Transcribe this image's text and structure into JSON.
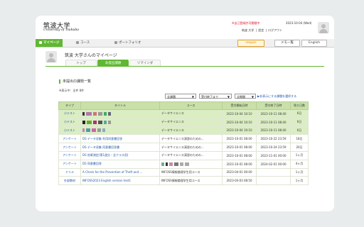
{
  "header": {
    "logo_ja": "筑波大学",
    "logo_en": "University of Tsukuba",
    "alert": "※自己登録許可期間中",
    "date": "2023-10-04 (Wed)",
    "links": [
      "筑波 大学",
      "|",
      "設定",
      "|",
      "ログアウト"
    ]
  },
  "nav": {
    "tabs": [
      {
        "label": "マイページ",
        "icon": "home-icon"
      },
      {
        "label": "コース",
        "icon": "course-icon"
      },
      {
        "label": "ポートフォリオ",
        "icon": "portfolio-icon"
      }
    ],
    "respon": "respon",
    "memo": "メモ一覧",
    "lang": "English"
  },
  "profile": {
    "title": "筑波 大学さんのマイページ",
    "subtabs": [
      "トップ",
      "未提出課題",
      "リマインダ"
    ]
  },
  "tasks": {
    "section_title": "未提出の課題一覧",
    "count": "※表示中：全件 8件",
    "filter_all": "全課題",
    "filter_deadline": "受付終了まで",
    "filter_period": "全期間",
    "show_link": "非表示にする課題を選択する",
    "columns": [
      "タイプ",
      "タイトル",
      "コース",
      "受付開始日時",
      "受付終了日時",
      "残り日数"
    ],
    "rows": [
      {
        "type": "小テスト",
        "title": "",
        "blocks": [
          {
            "c": "#333",
            "w": 3
          },
          {
            "c": "#b07aa8",
            "w": 8
          },
          {
            "c": "#c77",
            "w": 5
          },
          {
            "c": "#999",
            "w": 6
          },
          {
            "c": "#4a6",
            "w": 4
          },
          {
            "c": "#667",
            "w": 4
          }
        ],
        "course": "データサイエンス",
        "start": "2023-10-04 10:10",
        "end": "2023-10-11 08:40",
        "remain": "6日",
        "hl": true
      },
      {
        "type": "小テスト",
        "title": "",
        "blocks": [
          {
            "c": "#222",
            "w": 4
          },
          {
            "c": "#6a3",
            "w": 7
          },
          {
            "c": "#a37",
            "w": 5
          },
          {
            "c": "#555",
            "w": 6
          },
          {
            "c": "#5a9",
            "w": 4
          },
          {
            "c": "#999",
            "w": 4
          }
        ],
        "course": "データサイエンス",
        "start": "2023-10-04 10:10",
        "end": "2023-10-11 08:40",
        "remain": "6日",
        "hl": true
      },
      {
        "type": "小テスト",
        "title": "",
        "blocks": [
          {
            "c": "#b8a",
            "w": 3
          },
          {
            "c": "#59a",
            "w": 6
          },
          {
            "c": "#c6a",
            "w": 6
          },
          {
            "c": "#999",
            "w": 5
          },
          {
            "c": "#8ac",
            "w": 4
          }
        ],
        "course": "データサイエンス",
        "start": "2023-10-04 10:10",
        "end": "2023-10-11 08:40",
        "remain": "6日",
        "hl": true
      },
      {
        "type": "アンケート",
        "title": "DS データ収集 利用同意書回答",
        "blocks": [],
        "course": "データサイエンス演習のための...",
        "start": "2023-10-01 08:00",
        "end": "2023-10-22 23:59",
        "remain": "18日",
        "hl": false
      },
      {
        "type": "アンケート",
        "title": "DS データ収集 同意書回答書",
        "blocks": [],
        "course": "データサイエンス演習のための...",
        "start": "2023-10-01 08:00",
        "end": "2023-10-24 23:59",
        "remain": "20日",
        "hl": false
      },
      {
        "type": "アンケート",
        "title": "DS 効果測定(第1週分・全クラス用)",
        "blocks": [],
        "course": "データサイエンス演習のための...",
        "start": "2023-10-01 08:00",
        "end": "2023-11-01 00:00",
        "remain": "1ヶ月",
        "hl": false
      },
      {
        "type": "アンケート",
        "title": "DS 同意書回答",
        "blocks": [],
        "course": "",
        "courseblocks": [
          {
            "c": "#7a9",
            "w": 4
          },
          {
            "c": "#333",
            "w": 3
          },
          {
            "c": "#c8a",
            "w": 5
          },
          {
            "c": "#777",
            "w": 6
          },
          {
            "c": "#aaa",
            "w": 5
          },
          {
            "c": "#aaa",
            "w": 6
          }
        ],
        "start": "2023-10-01 08:00",
        "end": "2024-02-01 00:00",
        "remain": "4ヶ月",
        "hl": false
      },
      {
        "type": "ドリル",
        "title": "A Check for the Prevention of Theft and ...",
        "blocks": [],
        "course": "INFOSS情報倫理学生用コース",
        "start": "2023-04-01 00:00",
        "end": "",
        "remain": "1ヶ月",
        "hl": false
      },
      {
        "type": "外部教材",
        "title": "INFOSS2023 English version test1",
        "blocks": [],
        "course": "INFOSS情報倫理学生用コース",
        "start": "2023-04-03 08:50",
        "end": "",
        "remain": "1ヶ月",
        "hl": false
      }
    ]
  }
}
